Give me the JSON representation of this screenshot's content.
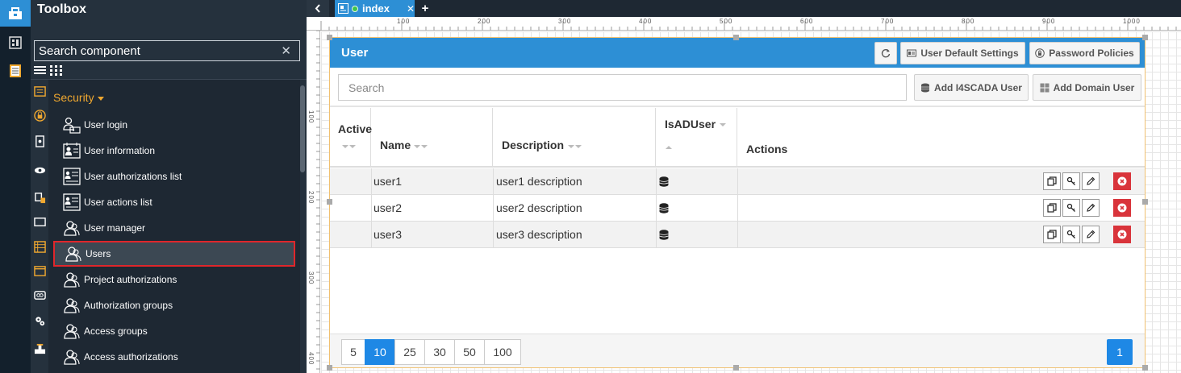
{
  "toolbox": {
    "title": "Toolbox",
    "search_placeholder": "Search component",
    "category": "Security",
    "items": [
      {
        "label": "User login",
        "icon": "user-login-icon"
      },
      {
        "label": "User information",
        "icon": "user-information-icon"
      },
      {
        "label": "User authorizations list",
        "icon": "user-list-icon"
      },
      {
        "label": "User actions list",
        "icon": "user-list-icon"
      },
      {
        "label": "User manager",
        "icon": "users-icon"
      },
      {
        "label": "Users",
        "icon": "users-icon",
        "selected": true
      },
      {
        "label": "Project authorizations",
        "icon": "users-icon"
      },
      {
        "label": "Authorization groups",
        "icon": "users-icon"
      },
      {
        "label": "Access groups",
        "icon": "users-icon"
      },
      {
        "label": "Access authorizations",
        "icon": "users-icon"
      }
    ]
  },
  "editor": {
    "tab_name": "index",
    "ruler_h": [
      "100",
      "200",
      "300",
      "400",
      "500",
      "600",
      "700",
      "800",
      "900",
      "1000"
    ],
    "ruler_v": [
      "100",
      "200",
      "300",
      "400"
    ]
  },
  "widget": {
    "title": "User",
    "refresh_icon": "refresh-icon",
    "user_default_settings": "User Default Settings",
    "password_policies": "Password Policies",
    "search_placeholder": "Search",
    "add_i4scada_user": "Add I4SCADA User",
    "add_domain_user": "Add Domain User",
    "columns": {
      "active": "Active",
      "name": "Name",
      "description": "Description",
      "isaduser": "IsADUser",
      "actions": "Actions"
    },
    "rows": [
      {
        "name": "user1",
        "description": "user1 description"
      },
      {
        "name": "user2",
        "description": "user2 description"
      },
      {
        "name": "user3",
        "description": "user3 description"
      }
    ],
    "page_sizes": [
      "5",
      "10",
      "25",
      "30",
      "50",
      "100"
    ],
    "selected_page_size": "10",
    "current_page": "1"
  },
  "colors": {
    "accent": "#2d8fd5",
    "category": "#f0a830",
    "selection": "#e0262b",
    "delete": "#d9343b"
  }
}
